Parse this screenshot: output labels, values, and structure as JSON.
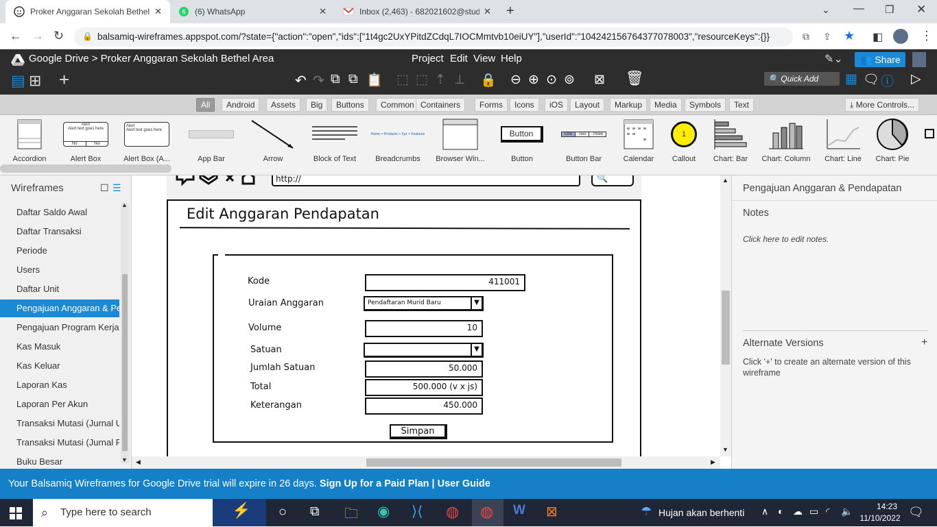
{
  "browser": {
    "tabs": [
      {
        "title": "Proker Anggaran Sekolah Bethel",
        "favicon": "balsamiq-icon",
        "active": true
      },
      {
        "title": "(6) WhatsApp",
        "favicon": "whatsapp-icon",
        "active": false
      },
      {
        "title": "Inbox (2,463) - 682021602@stud",
        "favicon": "gmail-icon",
        "active": false
      }
    ],
    "url": "balsamiq-wireframes.appspot.com/?state={\"action\":\"open\",\"ids\":[\"1t4gc2UxYPitdZCdqL7IOCMmtvb10eiUY\"],\"userId\":\"104242156764377078003\",\"resourceKeys\":{}}"
  },
  "app": {
    "breadcrumb": "Google Drive > Proker Anggaran Sekolah Bethel Area",
    "menu": [
      "Project",
      "Edit",
      "View",
      "Help"
    ],
    "share_label": "Share",
    "quick_add_placeholder": "Quick Add"
  },
  "library_tabs": [
    "All",
    "Android",
    "Assets",
    "Big",
    "Buttons",
    "Common",
    "Containers",
    "Forms",
    "Icons",
    "iOS",
    "Layout",
    "Markup",
    "Media",
    "Symbols",
    "Text"
  ],
  "more_controls": "More Controls...",
  "components": [
    "Accordion",
    "Alert Box",
    "Alert Box (A...",
    "App Bar",
    "Arrow",
    "Block of Text",
    "Breadcrumbs",
    "Browser Win...",
    "Button",
    "Button Bar",
    "Calendar",
    "Callout",
    "Chart: Bar",
    "Chart: Column",
    "Chart: Line",
    "Chart: Pie"
  ],
  "component_texts": {
    "button": "Button",
    "button_bar": [
      "One",
      "Two",
      "Three"
    ],
    "callout": "1",
    "alert": "Alert",
    "alert_body": "Alert text goes here",
    "alert_no": "No",
    "alert_yes": "Yes",
    "breadcrumbs": "Home > Products > Xyz > Features"
  },
  "sidebar": {
    "title": "Wireframes",
    "items": [
      "Daftar Saldo Awal",
      "Daftar Transaksi",
      "Periode",
      "Users",
      "Daftar Unit",
      "Pengajuan Anggaran & Pendapatan",
      "Pengajuan Program Kerja",
      "Kas Masuk",
      "Kas Keluar",
      "Laporan Kas",
      "Laporan Per Akun",
      "Transaksi Mutasi (Jurnal Umum)",
      "Transaksi Mutasi (Jurnal Penyesuaian)",
      "Buku Besar"
    ],
    "active_index": 5
  },
  "wireframe": {
    "url_text": "http://",
    "heading": "Edit Anggaran Pendapatan",
    "fields": [
      {
        "label": "Kode",
        "value": "411001"
      },
      {
        "label": "Uraian Anggaran",
        "value": "Pendaftaran Murid Baru"
      },
      {
        "label": "Volume",
        "value": "10"
      },
      {
        "label": "Satuan",
        "value": ""
      },
      {
        "label": "Jumlah Satuan",
        "value": "50.000"
      },
      {
        "label": "Total",
        "value": "500.000 (v x js)"
      },
      {
        "label": "Keterangan",
        "value": "450.000"
      }
    ],
    "submit": "Simpan"
  },
  "right_panel": {
    "title": "Pengajuan Anggaran & Pendapatan",
    "notes_heading": "Notes",
    "notes_placeholder": "Click here to edit notes.",
    "alt_heading": "Alternate Versions",
    "alt_add": "+",
    "alt_desc": "Click '+' to create an alternate version of this wireframe"
  },
  "banner": {
    "text": "Your Balsamiq Wireframes for Google Drive trial will expire in 26 days. ",
    "signup": "Sign Up for a Paid Plan",
    "sep": " | ",
    "guide": "User Guide"
  },
  "taskbar": {
    "search_placeholder": "Type here to search",
    "weather": "Hujan akan berhenti",
    "time": "14:23",
    "date": "11/10/2022"
  },
  "colors": {
    "accent": "#1a8ad6",
    "banner": "#1580c7",
    "header": "#2d2d2d",
    "taskbar": "#1f2736"
  }
}
